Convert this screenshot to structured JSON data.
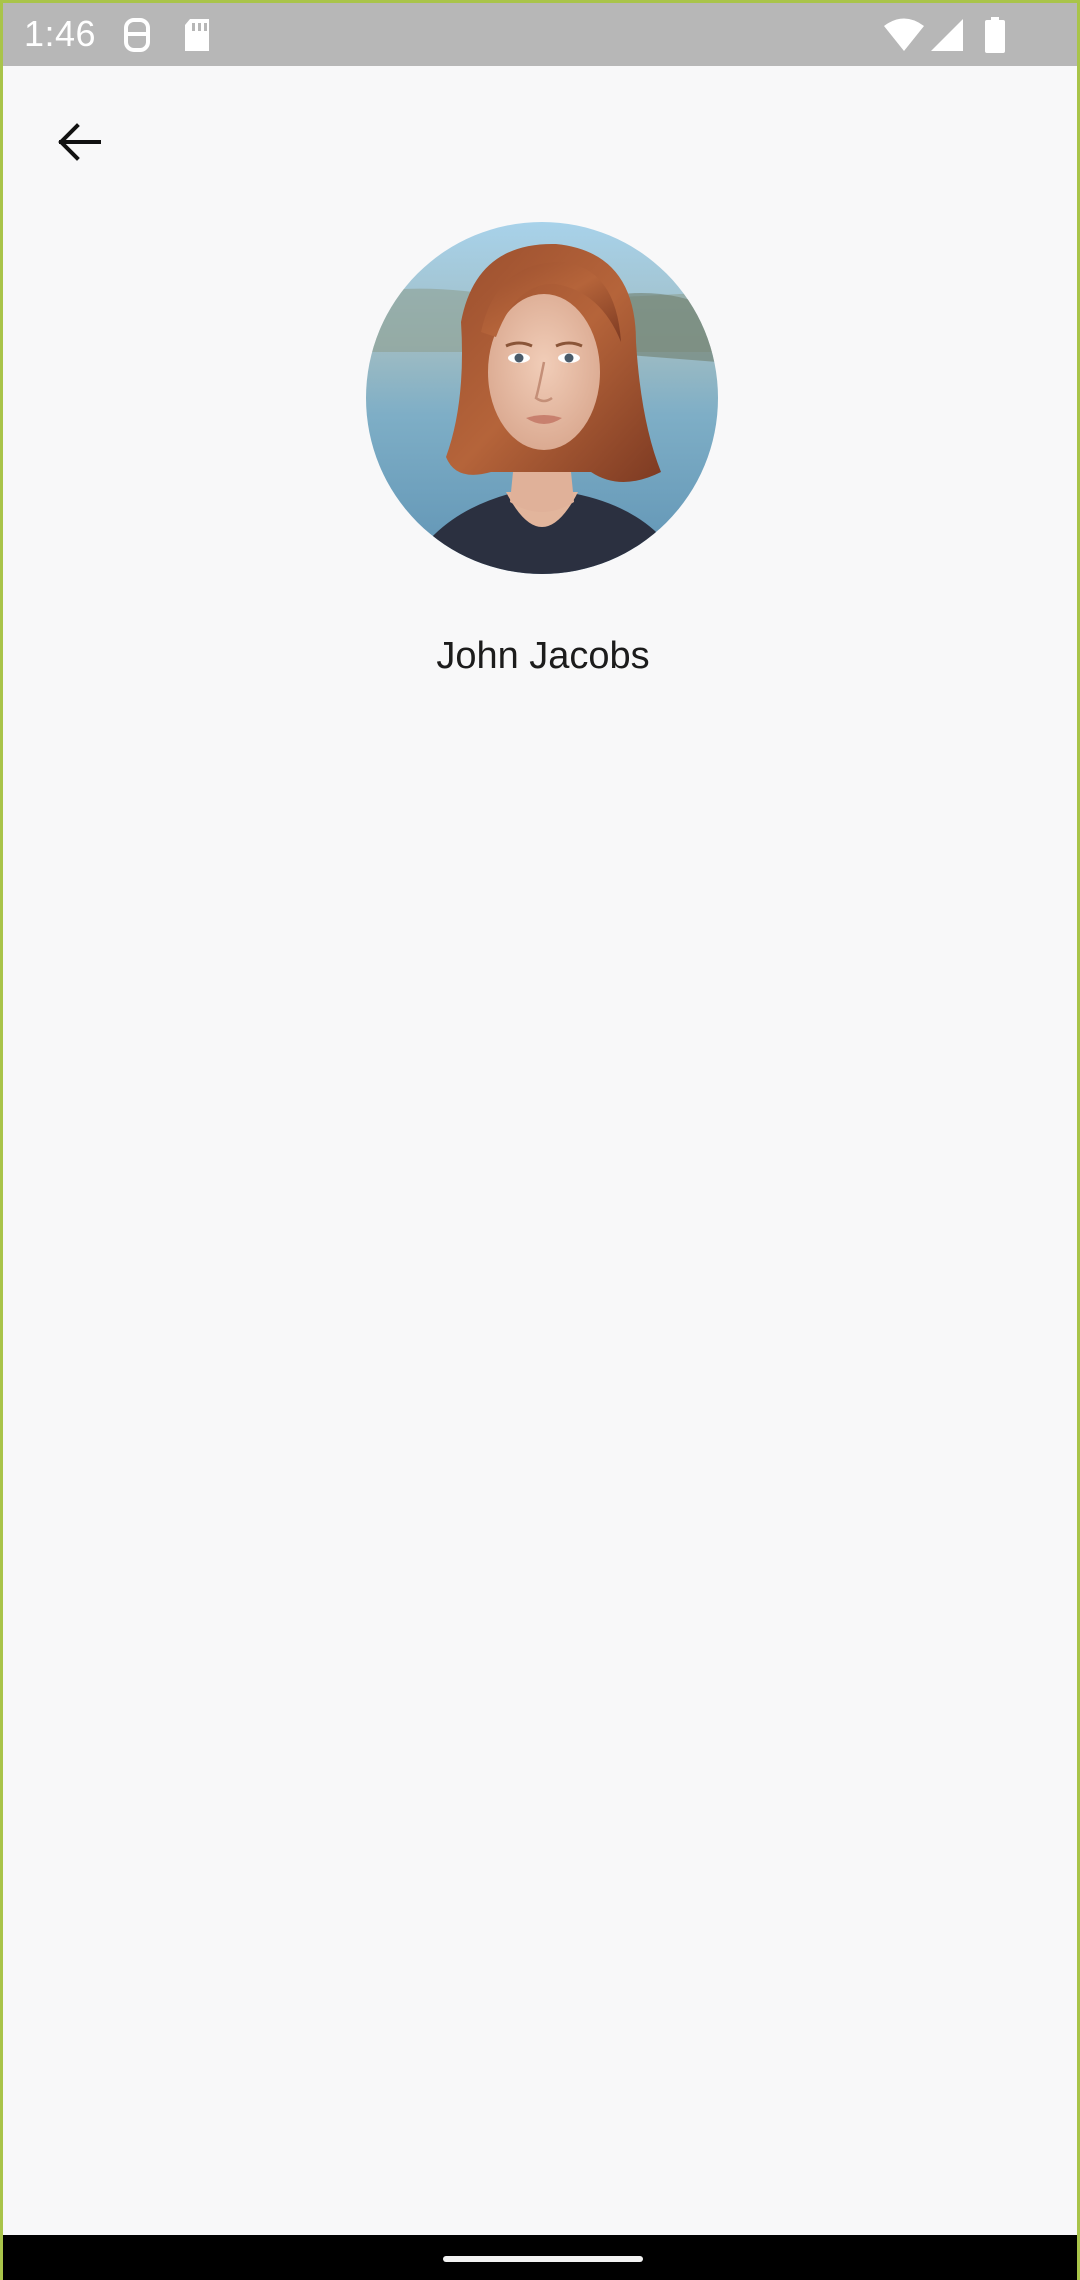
{
  "status_bar": {
    "time": "1:46",
    "icons": [
      "gallery-notification-icon",
      "sd-card-icon",
      "wifi-icon",
      "cellular-signal-icon",
      "battery-icon"
    ]
  },
  "toolbar": {
    "back_icon": "arrow-left-icon"
  },
  "profile": {
    "name": "John Jacobs",
    "avatar": "portrait-photo"
  },
  "colors": {
    "background": "#f8f8f9",
    "status_bar": "#b7b7b7",
    "nav_bar": "#000000",
    "frame_border": "#a9c44a"
  }
}
